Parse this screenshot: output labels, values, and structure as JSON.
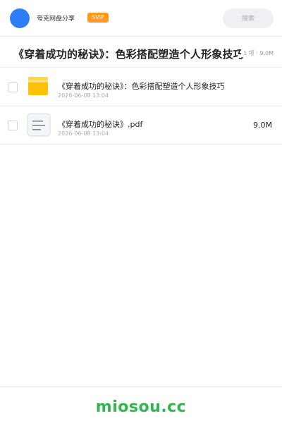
{
  "header": {
    "username": "夸克网盘分享",
    "vip_badge": "SVIP",
    "search_label": "搜索",
    "avatar_color": "#2c7df6",
    "badge_color": "#ff9a1f"
  },
  "share": {
    "title": "《穿着成功的秘诀》：色彩搭配塑造个人形象技巧",
    "meta": "1 项 · 9.0M"
  },
  "files": [
    {
      "name": "《穿着成功的秘诀》：色彩搭配塑造个人形象技巧",
      "date": "2026-06-08 13:04",
      "size": "",
      "icon": "folder-icon"
    },
    {
      "name": "《穿着成功的秘诀》.pdf",
      "date": "2026-06-08 13:04",
      "size": "9.0M",
      "icon": "pdf-document-icon"
    }
  ],
  "footer": {
    "brand": "miosou.cc",
    "brand_color": "#2db84d"
  }
}
